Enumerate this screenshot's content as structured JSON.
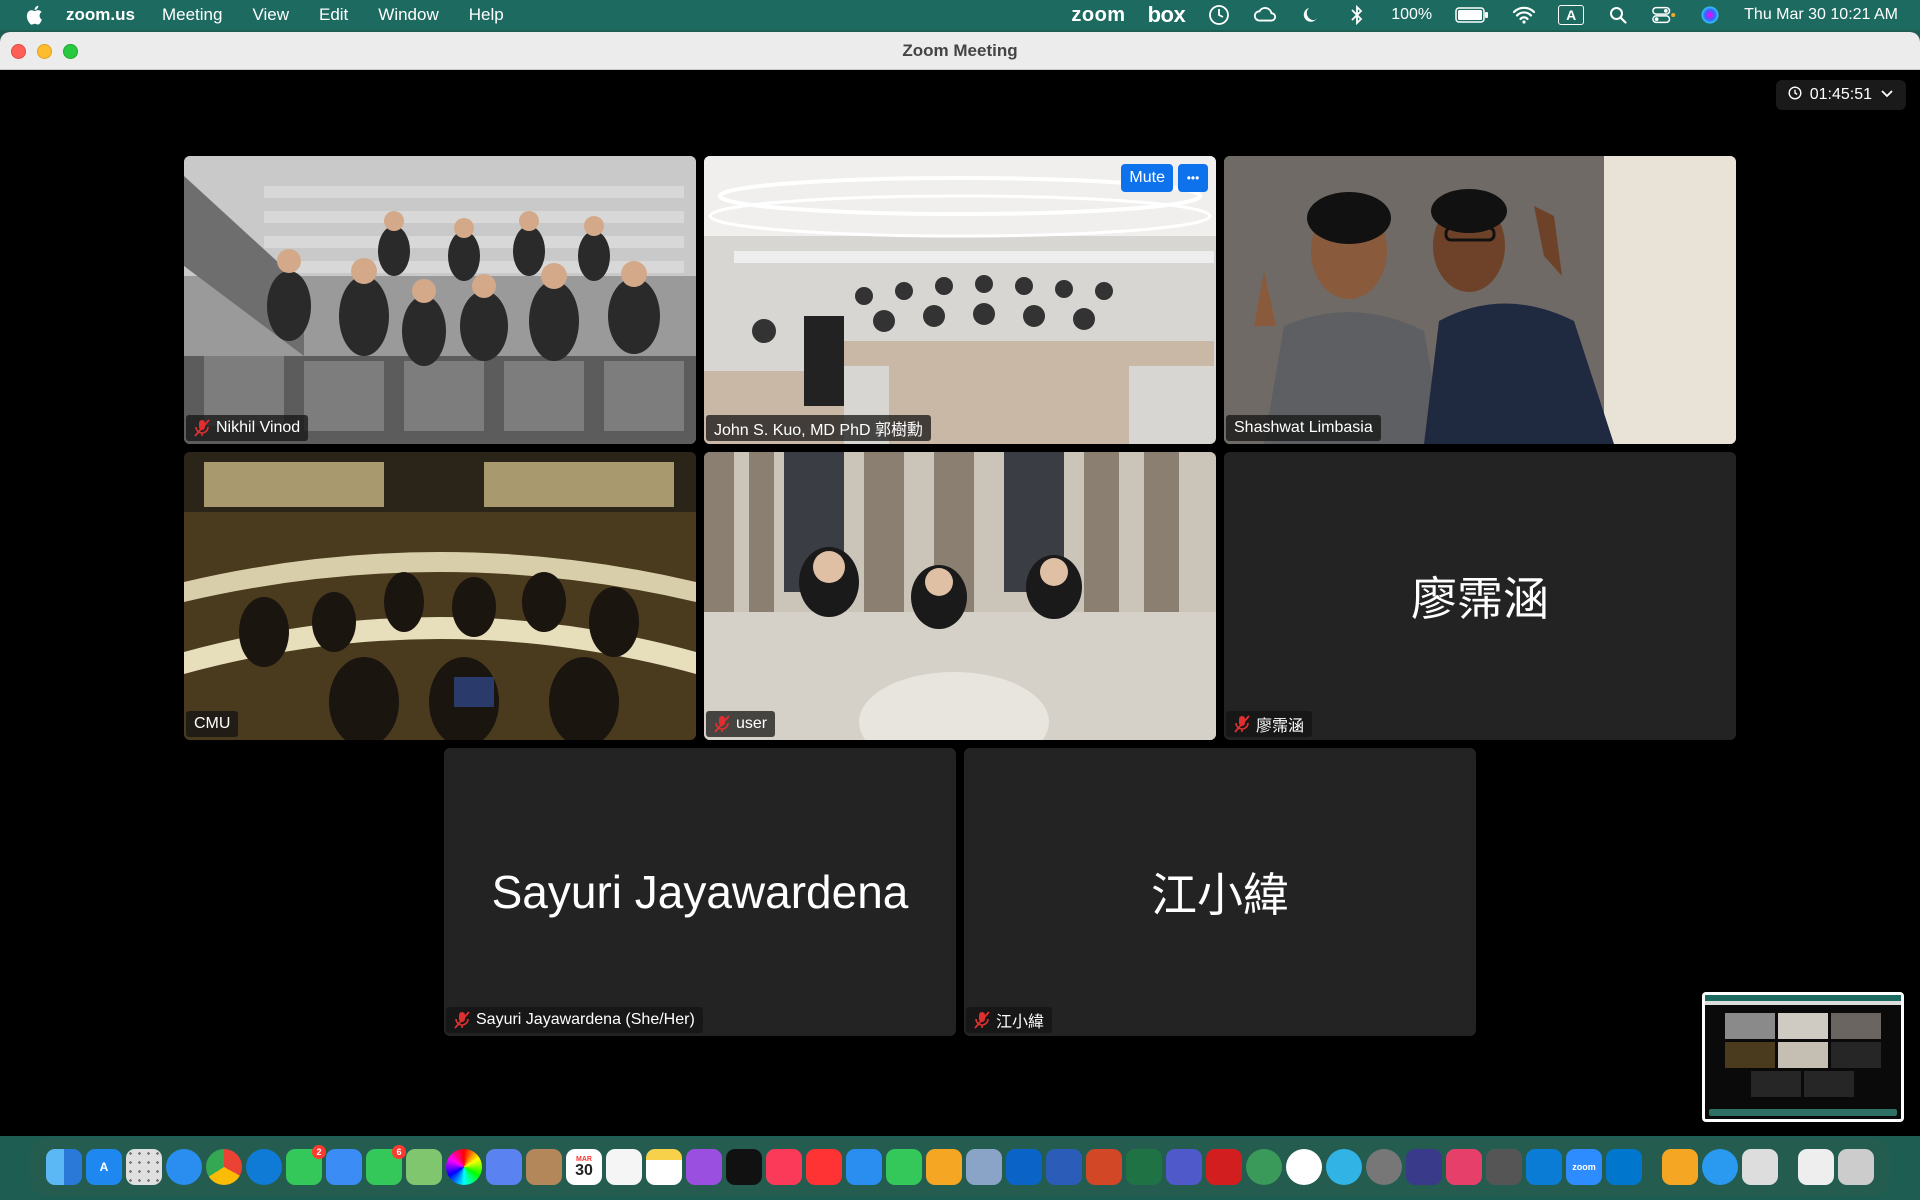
{
  "menubar": {
    "app_name": "zoom.us",
    "items": [
      "Meeting",
      "View",
      "Edit",
      "Window",
      "Help"
    ],
    "zoom_word": "zoom",
    "box_word": "box",
    "battery": "100%",
    "keyboard_input": "A",
    "datetime": "Thu Mar 30  10:21 AM"
  },
  "window": {
    "title": "Zoom Meeting",
    "timer": "01:45:51"
  },
  "tiles": [
    {
      "name": "Nikhil Vinod",
      "muted": true,
      "has_video": true
    },
    {
      "name": "John S. Kuo, MD PhD 郭樹勳",
      "muted": false,
      "has_video": true,
      "hover_mute": "Mute",
      "hover_more": "•••"
    },
    {
      "name": "Shashwat Limbasia",
      "muted": false,
      "has_video": true,
      "active_speaker": true
    },
    {
      "name": "CMU",
      "muted": false,
      "has_video": true
    },
    {
      "name": "user",
      "muted": true,
      "has_video": true
    },
    {
      "name": "廖霈涵",
      "muted": true,
      "has_video": false,
      "big_label": "廖霈涵"
    },
    {
      "name": "Sayuri Jayawardena (She/Her)",
      "muted": true,
      "has_video": false,
      "big_label": "Sayuri Jayawardena"
    },
    {
      "name": "江小緯",
      "muted": true,
      "has_video": false,
      "big_label": "江小緯"
    }
  ],
  "dock": {
    "calendar_month": "MAR",
    "calendar_day": "30",
    "facetime_badge": "2",
    "messages_badge": "6",
    "zoom_label": "zoom"
  },
  "colors": {
    "menubar_bg": "#1d6b60",
    "active_speaker": "#2ecc71",
    "button_blue": "#0e72ed",
    "muted_red": "#e02f2f"
  }
}
